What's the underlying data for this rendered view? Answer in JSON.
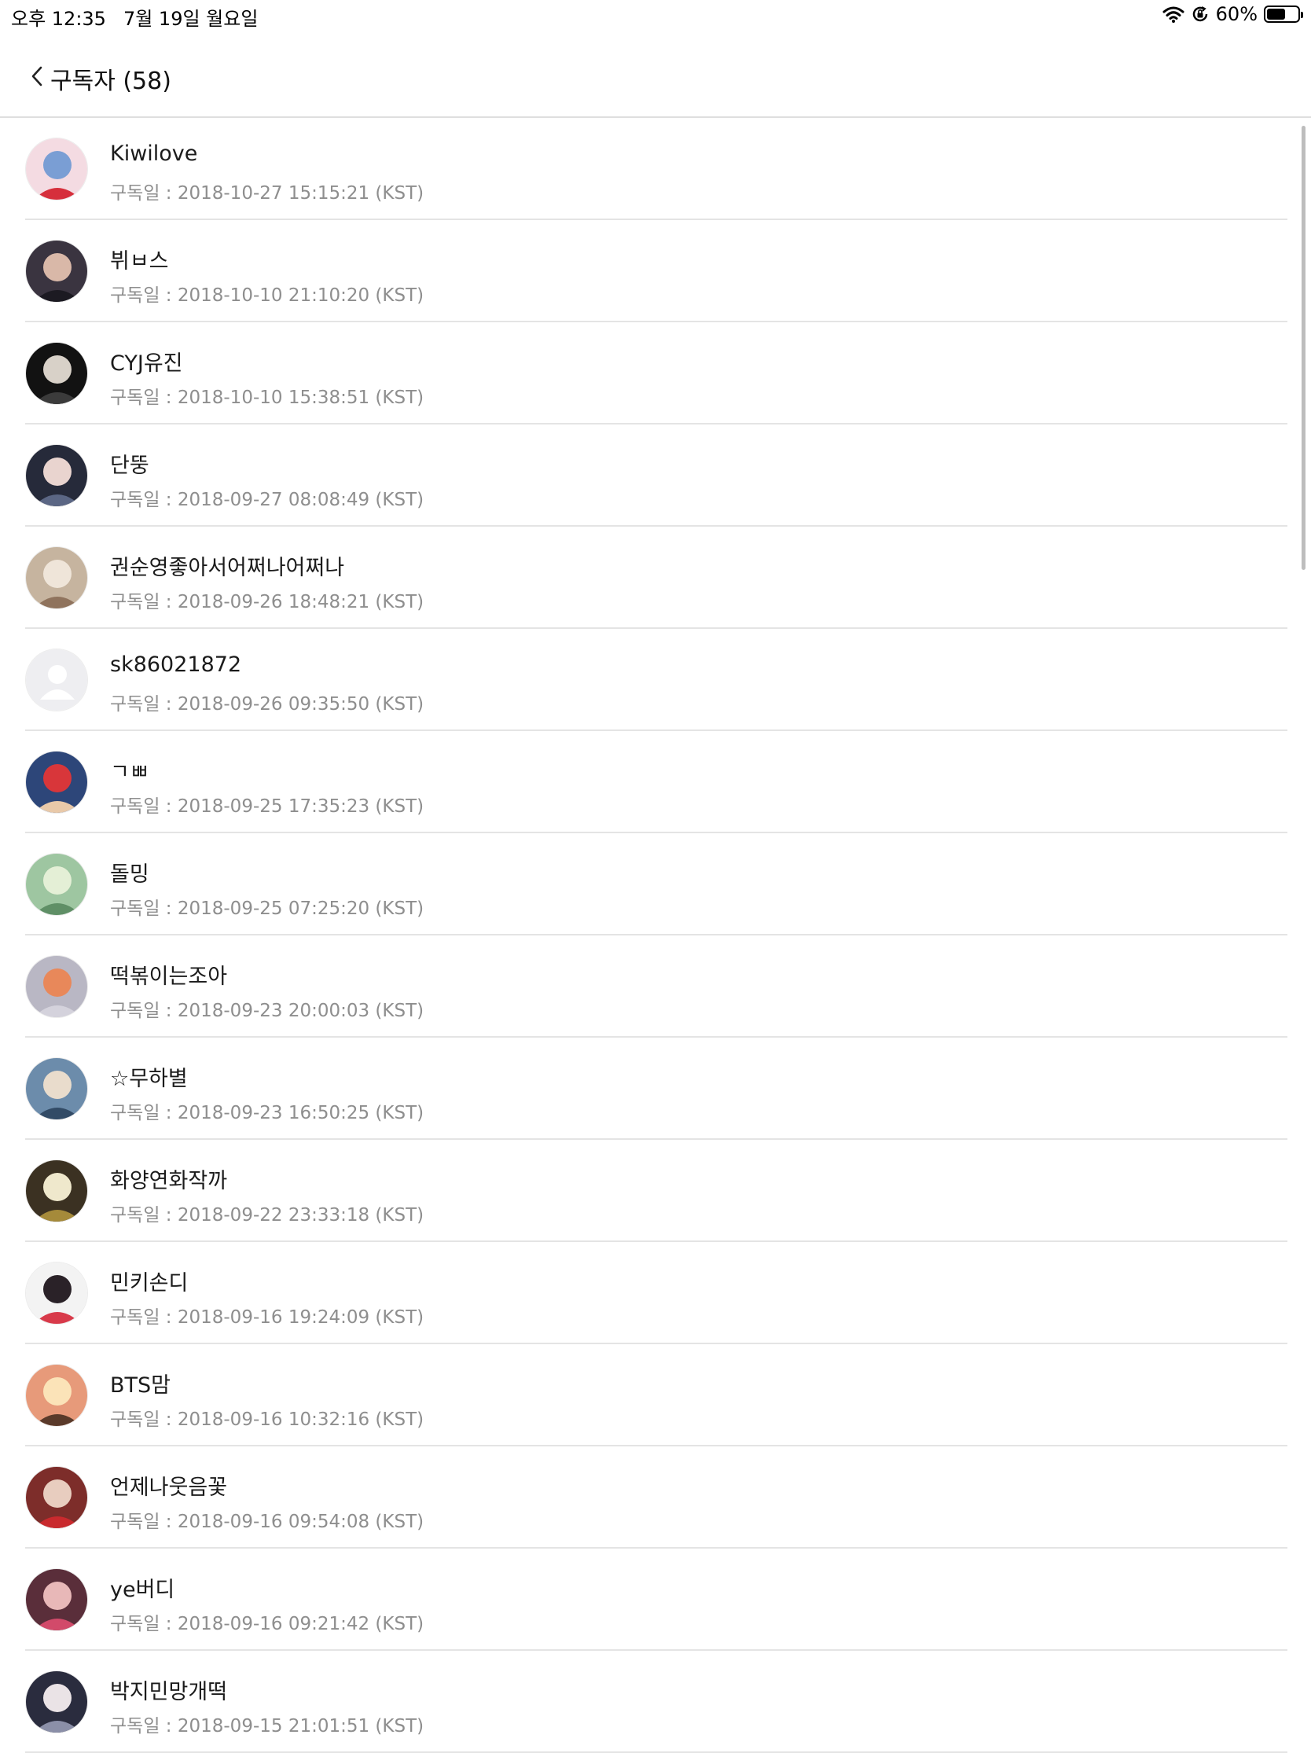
{
  "status_bar": {
    "time": "오후 12:35",
    "date": "7월 19일 월요일",
    "battery_text": "60%",
    "battery_level": 0.6,
    "icons": [
      "wifi-icon",
      "orientation-lock-icon",
      "battery-icon"
    ]
  },
  "header": {
    "back_icon": "chevron-left-icon",
    "title": "구독자 (58)"
  },
  "subscribers": [
    {
      "name": "Kiwilove",
      "date": "구독일 : 2018-10-27 15:15:21 (KST)",
      "avatar_colors": [
        "#f4dbe2",
        "#7a9ed4",
        "#d62f3c"
      ]
    },
    {
      "name": "뷔ㅂ스",
      "date": "구독일 : 2018-10-10 21:10:20 (KST)",
      "avatar_colors": [
        "#3a3440",
        "#d9b8a8",
        "#1c1a22"
      ]
    },
    {
      "name": "CYJ유진",
      "date": "구독일 : 2018-10-10 15:38:51 (KST)",
      "avatar_colors": [
        "#121212",
        "#d8d1c8",
        "#3b3b3b"
      ]
    },
    {
      "name": "단뚱",
      "date": "구독일 : 2018-09-27 08:08:49 (KST)",
      "avatar_colors": [
        "#262a3a",
        "#e9d4cf",
        "#5b6684"
      ]
    },
    {
      "name": "권순영좋아서어쩌나어쩌나",
      "date": "구독일 : 2018-09-26 18:48:21 (KST)",
      "avatar_colors": [
        "#c6b49f",
        "#efe5d9",
        "#8f735d"
      ]
    },
    {
      "name": "sk86021872",
      "date": "구독일 : 2018-09-26 09:35:50 (KST)",
      "avatar_colors": [
        "#eeeef1",
        "#ffffff",
        "#e0e0e4"
      ],
      "default_avatar": true
    },
    {
      "name": "ㄱㅃ",
      "date": "구독일 : 2018-09-25 17:35:23 (KST)",
      "avatar_colors": [
        "#2d4679",
        "#d8363a",
        "#e9c9a9"
      ]
    },
    {
      "name": "돌밍",
      "date": "구독일 : 2018-09-25 07:25:20 (KST)",
      "avatar_colors": [
        "#9ec6a1",
        "#e4efd6",
        "#5f8f66"
      ]
    },
    {
      "name": "떡볶이는조아",
      "date": "구독일 : 2018-09-23 20:00:03 (KST)",
      "avatar_colors": [
        "#b9b7c4",
        "#e8885a",
        "#d4d2dc"
      ]
    },
    {
      "name": "☆무하별",
      "date": "구독일 : 2018-09-23 16:50:25 (KST)",
      "avatar_colors": [
        "#6c8cab",
        "#e9dccc",
        "#324b66"
      ]
    },
    {
      "name": "화양연화작까",
      "date": "구독일 : 2018-09-22 23:33:18 (KST)",
      "avatar_colors": [
        "#3b3122",
        "#efe8cc",
        "#a58a3a"
      ]
    },
    {
      "name": "민키손디",
      "date": "구독일 : 2018-09-16 19:24:09 (KST)",
      "avatar_colors": [
        "#f3f3f3",
        "#2a2228",
        "#d83a4a"
      ]
    },
    {
      "name": "BTS맘",
      "date": "구독일 : 2018-09-16 10:32:16 (KST)",
      "avatar_colors": [
        "#e79a7a",
        "#fbe3b8",
        "#5a3a2a"
      ]
    },
    {
      "name": "언제나웃음꽃",
      "date": "구독일 : 2018-09-16 09:54:08 (KST)",
      "avatar_colors": [
        "#7d2d2a",
        "#e8cdbf",
        "#c92a2e"
      ]
    },
    {
      "name": "ye버디",
      "date": "구독일 : 2018-09-16 09:21:42 (KST)",
      "avatar_colors": [
        "#5a2e3a",
        "#e8b8b8",
        "#d24a6a"
      ]
    },
    {
      "name": "박지민망개떡",
      "date": "구독일 : 2018-09-15 21:01:51 (KST)",
      "avatar_colors": [
        "#2a2c3e",
        "#eae3e6",
        "#8b8fa8"
      ]
    }
  ]
}
